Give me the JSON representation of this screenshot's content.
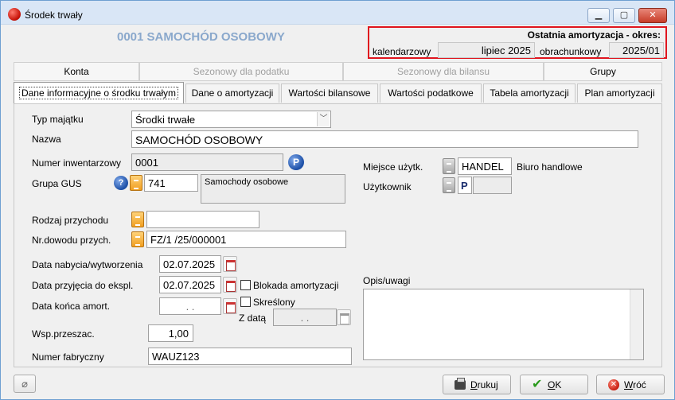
{
  "window": {
    "title": "Środek trwały"
  },
  "header": {
    "asset_title": "0001 SAMOCHÓD OSOBOWY",
    "amortization": {
      "heading": "Ostatnia amortyzacja - okres:",
      "calendar_label": "kalendarzowy",
      "calendar_value": "lipiec 2025",
      "accounting_label": "obrachunkowy",
      "accounting_value": "2025/01"
    }
  },
  "tabs_upper": [
    {
      "label": "Konta",
      "enabled": true
    },
    {
      "label": "Sezonowy dla podatku",
      "enabled": false
    },
    {
      "label": "Sezonowy dla bilansu",
      "enabled": false
    },
    {
      "label": "Grupy",
      "enabled": true
    }
  ],
  "tabs_lower": [
    {
      "label": "Dane informacyjne o środku trwałym",
      "active": true
    },
    {
      "label": "Dane o amortyzacji",
      "active": false
    },
    {
      "label": "Wartości bilansowe",
      "active": false
    },
    {
      "label": "Wartości podatkowe",
      "active": false
    },
    {
      "label": "Tabela amortyzacji",
      "active": false
    },
    {
      "label": "Plan amortyzacji",
      "active": false
    }
  ],
  "form": {
    "asset_type": {
      "label": "Typ majątku",
      "value": "Środki trwałe"
    },
    "name": {
      "label": "Nazwa",
      "value": "SAMOCHÓD OSOBOWY"
    },
    "inventory_number": {
      "label": "Numer inwentarzowy",
      "value": "0001"
    },
    "gus_group": {
      "label": "Grupa GUS",
      "code": "741",
      "description": "Samochody osobowe"
    },
    "income_type": {
      "label": "Rodzaj przychodu",
      "value": ""
    },
    "receipt_doc": {
      "label": "Nr.dowodu przych.",
      "value": "FZ/1  /25/000001"
    },
    "acquisition_date": {
      "label": "Data nabycia/wytworzenia",
      "value": "02.07.2025"
    },
    "commissioning_date": {
      "label": "Data przyjęcia do ekspl.",
      "value": "02.07.2025"
    },
    "amort_end_date": {
      "label": "Data końca amort.",
      "value": ". ."
    },
    "amort_block": {
      "label": "Blokada amortyzacji",
      "checked": false
    },
    "removed": {
      "label": "Skreślony",
      "checked": false
    },
    "removed_date": {
      "label": "Z datą",
      "value": ". ."
    },
    "revaluation": {
      "label": "Wsp.przeszac.",
      "value": "1,00"
    },
    "serial_number": {
      "label": "Numer fabryczny",
      "value": "WAUZ123"
    },
    "location": {
      "label": "Miejsce użytk.",
      "code": "HANDEL",
      "description": "Biuro handlowe"
    },
    "user": {
      "label": "Użytkownik",
      "code": "P",
      "value": ""
    },
    "notes": {
      "label": "Opis/uwagi",
      "value": ""
    }
  },
  "buttons": {
    "print": "Drukuj",
    "print_key": "D",
    "print_rest": "rukuj",
    "ok": "OK",
    "ok_key": "O",
    "ok_rest": "K",
    "back": "Wróć",
    "back_key": "W",
    "back_rest": "róć"
  },
  "icons": {
    "app": "app-icon",
    "attach": "paperclip-icon"
  }
}
